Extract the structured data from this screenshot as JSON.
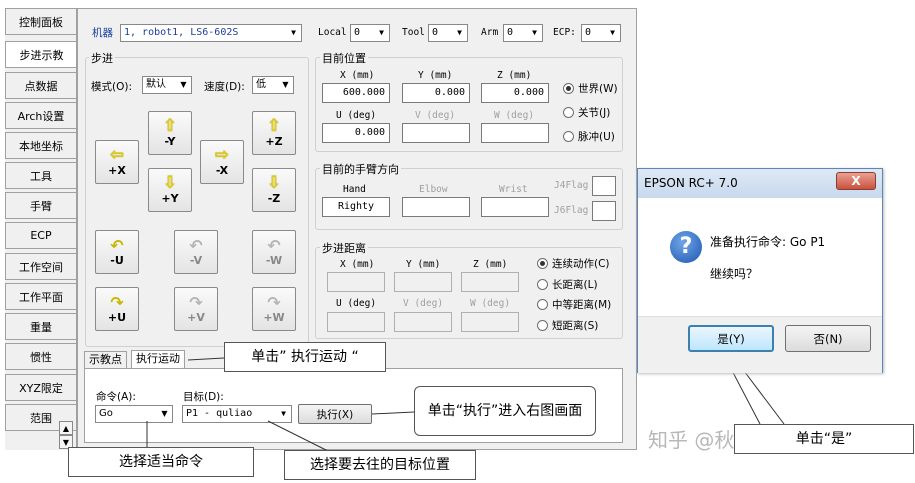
{
  "side_tabs": [
    "控制面板",
    "步进示教",
    "点数据",
    "Arch设置",
    "本地坐标",
    "工具",
    "手臂",
    "ECP",
    "工作空间",
    "工作平面",
    "重量",
    "惯性",
    "XYZ限定",
    "范围"
  ],
  "header": {
    "robot_label": "机器",
    "robot_value": "1, robot1, LS6-602S",
    "local_label": "Local",
    "local_value": "0",
    "tool_label": "Tool",
    "tool_value": "0",
    "arm_label": "Arm",
    "arm_value": "0",
    "ecp_label": "ECP:",
    "ecp_value": "0"
  },
  "jog": {
    "title": "步进",
    "mode_label": "模式(O):",
    "mode_value": "默认",
    "speed_label": "速度(D):",
    "speed_value": "低",
    "buttons": {
      "py": "-Y",
      "pz": "+Z",
      "mx": "+X",
      "nx": "-X",
      "my": "+Y",
      "mz": "-Z",
      "mu": "-U",
      "mv": "-V",
      "mw": "-W",
      "pu": "+U",
      "pv": "+V",
      "pw": "+W"
    }
  },
  "position": {
    "title": "目前位置",
    "x_label": "X (mm)",
    "x_value": "600.000",
    "y_label": "Y (mm)",
    "y_value": "0.000",
    "z_label": "Z (mm)",
    "z_value": "0.000",
    "u_label": "U (deg)",
    "u_value": "0.000",
    "v_label": "V (deg)",
    "v_value": "",
    "w_label": "W (deg)",
    "w_value": "",
    "frames": [
      "世界(W)",
      "关节(J)",
      "脉冲(U)"
    ],
    "selected_frame": "世界(W)"
  },
  "orientation": {
    "title": "目前的手臂方向",
    "hand_label": "Hand",
    "hand_value": "Righty",
    "elbow_label": "Elbow",
    "wrist_label": "Wrist",
    "j4_label": "J4Flag",
    "j6_label": "J6Flag"
  },
  "jog_distance": {
    "title": "步进距离",
    "x_label": "X (mm)",
    "y_label": "Y (mm)",
    "z_label": "Z (mm)",
    "u_label": "U (deg)",
    "v_label": "V (deg)",
    "w_label": "W (deg)",
    "modes": [
      "连续动作(C)",
      "长距离(L)",
      "中等距离(M)",
      "短距离(S)"
    ],
    "selected_mode": "连续动作(C)"
  },
  "bottom": {
    "tabs": [
      "示教点",
      "执行运动"
    ],
    "active_tab": "执行运动",
    "command_label": "命令(A):",
    "command_value": "Go",
    "target_label": "目标(D):",
    "target_value": "P1 - quliao",
    "execute_label": "执行(X)"
  },
  "callouts": {
    "click_exec_motion": "单击” 执行运动 “",
    "click_execute": "单击“执行”进入右图画面",
    "choose_command": "选择适当命令",
    "choose_target": "选择要去往的目标位置",
    "click_yes": "单击“是”"
  },
  "dialog": {
    "title": "EPSON RC+ 7.0",
    "message": "准备执行命令: Go P1",
    "question": "继续吗？",
    "yes_label": "是(Y)",
    "no_label": "否(N)",
    "close_label": "X"
  },
  "watermark": "知乎 @秋刀鱼的滋味",
  "icons": {
    "scroll_up": "▲",
    "scroll_down": "▼",
    "dropdown": "▼",
    "question": "?"
  }
}
